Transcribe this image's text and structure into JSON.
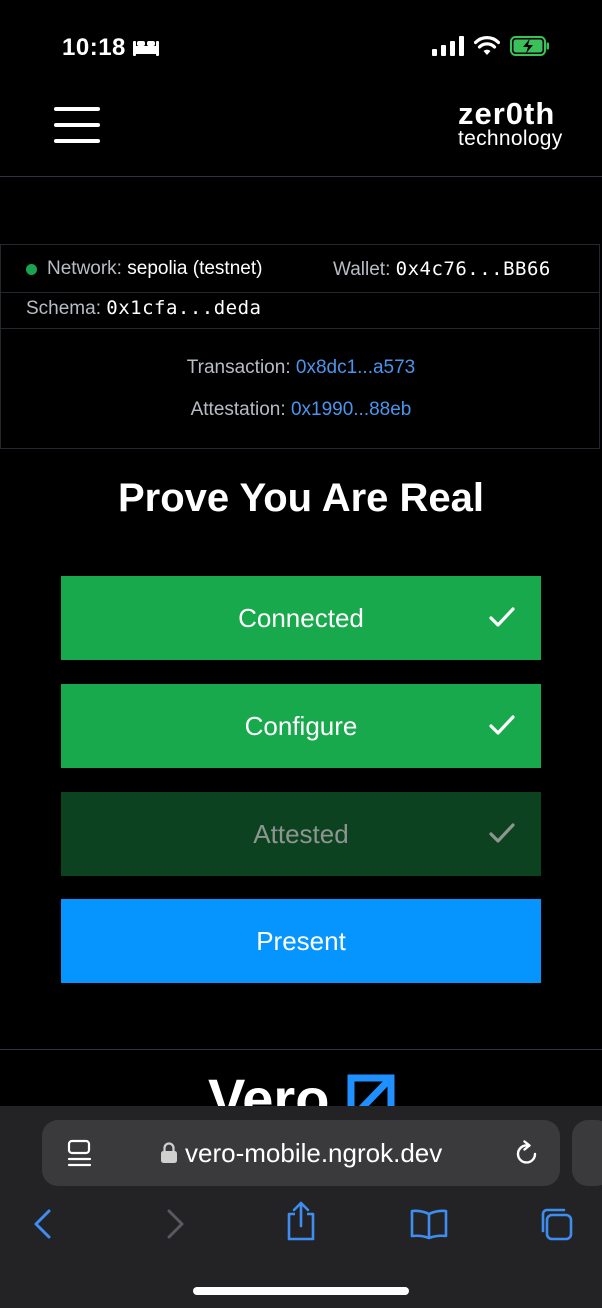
{
  "status_bar": {
    "time": "10:18"
  },
  "header": {
    "logo_line1": "zer0th",
    "logo_line2": "technology"
  },
  "info": {
    "network_label": "Network:",
    "network_value": "sepolia (testnet)",
    "wallet_label": "Wallet:",
    "wallet_value": "0x4c76...BB66",
    "schema_label": "Schema:",
    "schema_value": "0x1cfa...deda",
    "transaction_label": "Transaction:",
    "transaction_value": "0x8dc1...a573",
    "attestation_label": "Attestation:",
    "attestation_value": "0x1990...88eb"
  },
  "main": {
    "title": "Prove You Are Real",
    "steps": [
      {
        "label": "Connected",
        "done": true
      },
      {
        "label": "Configure",
        "done": true
      },
      {
        "label": "Attested",
        "done": true
      },
      {
        "label": "Present",
        "done": false
      }
    ]
  },
  "footer": {
    "logo": "Vero"
  },
  "browser": {
    "url": "vero-mobile.ngrok.dev"
  },
  "colors": {
    "success_green": "#19a94d",
    "attested_dark_green": "#0c4220",
    "present_blue": "#0695ff",
    "link_blue": "#4a95ec",
    "network_dot": "#19a550"
  }
}
